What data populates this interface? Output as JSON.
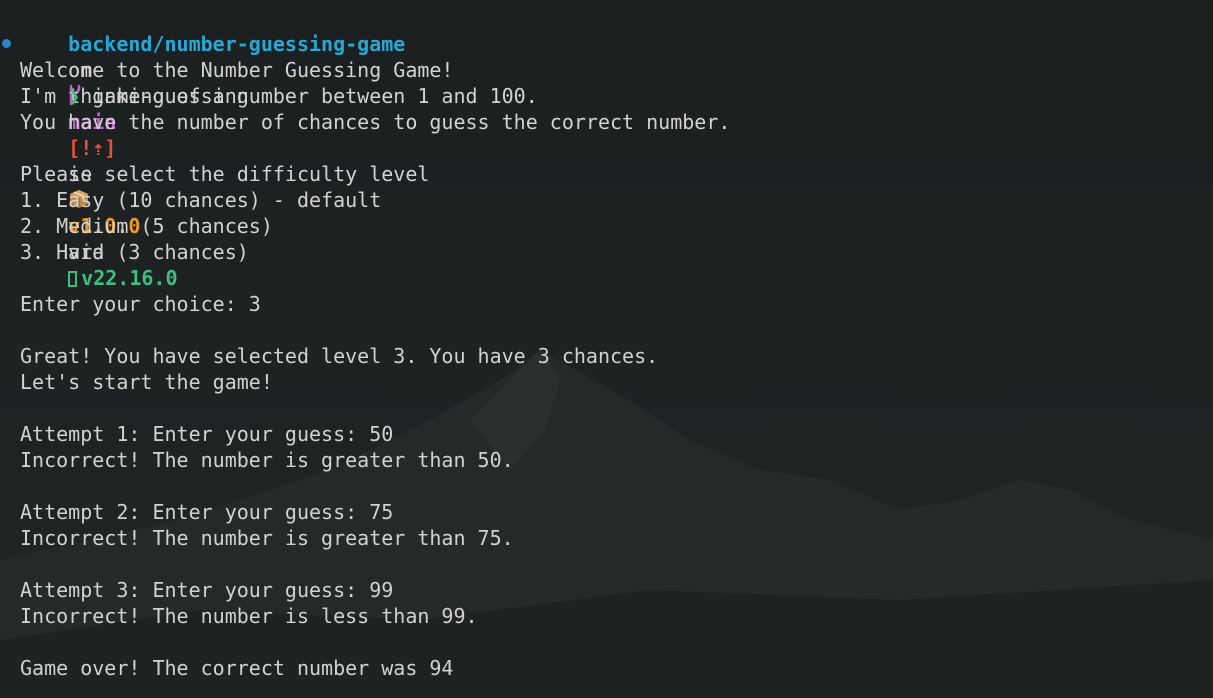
{
  "prompt": {
    "path": "backend/number-guessing-game",
    "on": "on",
    "branch_icon": "git-branch-icon",
    "branch": "main",
    "git_status": "[!⇡]",
    "is": "is",
    "package_icon": "package-icon",
    "version": "v1.0.0",
    "via": "via",
    "node_icon": "nodejs-icon",
    "node_version": "v22.16.0",
    "colors": {
      "path": "#29a7d4",
      "branch": "#c061cb",
      "git_status": "#e0533f",
      "version": "#ef9a1f",
      "node": "#3fbf7f",
      "bullet": "#2a86c5",
      "chevron": "#3fbf7f"
    }
  },
  "command": {
    "chevron": "❯",
    "text": "game-guessing"
  },
  "output": [
    "Welcome to the Number Guessing Game!",
    "I'm thinking of a number between 1 and 100.",
    "You have the number of chances to guess the correct number.",
    "",
    "Please select the difficulty level",
    "1. Easy (10 chances) - default",
    "2. Medium (5 chances)",
    "3. Hard (3 chances)",
    "",
    "Enter your choice: 3",
    "",
    "Great! You have selected level 3. You have 3 chances.",
    "Let's start the game!",
    "",
    "Attempt 1: Enter your guess: 50",
    "Incorrect! The number is greater than 50.",
    "",
    "Attempt 2: Enter your guess: 75",
    "Incorrect! The number is greater than 75.",
    "",
    "Attempt 3: Enter your guess: 99",
    "Incorrect! The number is less than 99.",
    "",
    "Game over! The correct number was 94"
  ]
}
